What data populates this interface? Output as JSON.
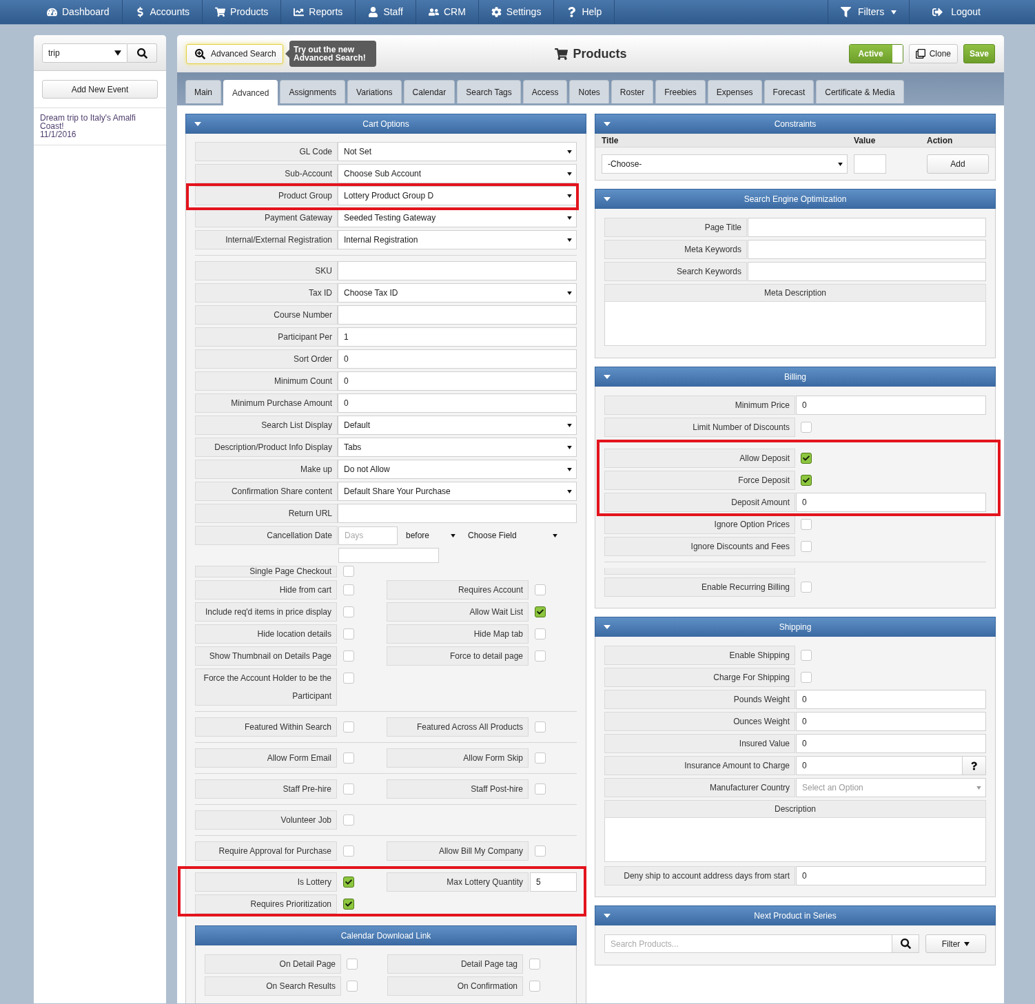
{
  "nav": {
    "items": [
      {
        "label": "Dashboard"
      },
      {
        "label": "Accounts"
      },
      {
        "label": "Products"
      },
      {
        "label": "Reports"
      },
      {
        "label": "Staff"
      },
      {
        "label": "CRM"
      },
      {
        "label": "Settings"
      },
      {
        "label": "Help"
      }
    ],
    "right_items": [
      {
        "label": "Filters",
        "kind": "menu"
      },
      {
        "label": "Logout",
        "kind": "link"
      }
    ]
  },
  "sidebar": {
    "search": {
      "value": "trip"
    },
    "add_button": "Add New Event",
    "events": [
      {
        "title": "Dream trip to Italy's Amalfi Coast!",
        "date": "11/1/2016"
      }
    ]
  },
  "header": {
    "advanced_search": {
      "label": "Advanced Search",
      "tooltip": "Try out the new Advanced Search!"
    },
    "title": "Products",
    "status": {
      "label": "Active",
      "on": true
    },
    "buttons": [
      {
        "label": "Clone",
        "kind": "clone"
      },
      {
        "label": "Save",
        "kind": "save"
      }
    ]
  },
  "tabs": [
    {
      "label": "Main",
      "selected": false
    },
    {
      "label": "Advanced",
      "selected": true
    },
    {
      "label": "Assignments",
      "selected": false
    },
    {
      "label": "Variations",
      "selected": false
    },
    {
      "label": "Calendar",
      "selected": false
    },
    {
      "label": "Search Tags",
      "selected": false
    },
    {
      "label": "Access",
      "selected": false
    },
    {
      "label": "Notes",
      "selected": false
    },
    {
      "label": "Roster",
      "selected": false
    },
    {
      "label": "Freebies",
      "selected": false
    },
    {
      "label": "Expenses",
      "selected": false
    },
    {
      "label": "Forecast",
      "selected": false
    },
    {
      "label": "Certificate & Media",
      "selected": false
    }
  ],
  "cart_options": {
    "title": "Cart Options",
    "sections": [
      {
        "rows": [
          {
            "kind": "select",
            "label": "GL Code",
            "value": "Not Set",
            "highlighted": false
          },
          {
            "kind": "select",
            "label": "Sub-Account",
            "value": "Choose Sub Account",
            "highlighted": false
          },
          {
            "kind": "select",
            "label": "Product Group",
            "value": "Lottery Product Group D",
            "highlighted": true
          },
          {
            "kind": "select",
            "label": "Payment Gateway",
            "value": "Seeded Testing Gateway",
            "highlighted": false
          },
          {
            "kind": "select",
            "label": "Internal/External Registration",
            "value": "Internal Registration",
            "highlighted": false
          }
        ]
      },
      {
        "rows": [
          {
            "kind": "text",
            "label": "SKU"
          },
          {
            "kind": "select",
            "label": "Tax ID",
            "value": "Choose Tax ID"
          },
          {
            "kind": "text",
            "label": "Course Number"
          },
          {
            "kind": "text",
            "label": "Participant Per",
            "value": "1"
          },
          {
            "kind": "text",
            "label": "Sort Order",
            "value": "0"
          },
          {
            "kind": "text",
            "label": "Minimum Count",
            "value": "0"
          },
          {
            "kind": "text",
            "label": "Minimum Purchase Amount",
            "value": "0"
          },
          {
            "kind": "select",
            "label": "Search List Display",
            "value": "Default"
          },
          {
            "kind": "select",
            "label": "Description/Product Info Display",
            "value": "Tabs"
          },
          {
            "kind": "select",
            "label": "Make up",
            "value": "Do not Allow"
          },
          {
            "kind": "select",
            "label": "Confirmation Share content",
            "value": "Default Share Your Purchase"
          },
          {
            "kind": "text",
            "label": "Return URL"
          },
          {
            "kind": "cancellation",
            "label": "Cancellation Date",
            "placeholder": "Days",
            "timing": "before",
            "field": "Choose Field"
          },
          {
            "kind": "blank_input"
          },
          {
            "kind": "checks",
            "left": {
              "label": "Single Page Checkout",
              "checked": false
            }
          },
          {
            "kind": "checks",
            "left": {
              "label": "Hide from cart",
              "checked": false
            },
            "right": {
              "kind": "checkbox",
              "label": "Requires Account",
              "checked": false
            }
          },
          {
            "kind": "checks",
            "left": {
              "label": "Include req'd items in price display",
              "checked": false
            },
            "right": {
              "kind": "checkbox",
              "label": "Allow Wait List",
              "checked": true
            }
          },
          {
            "kind": "checks",
            "left": {
              "label": "Hide location details",
              "checked": false
            },
            "right": {
              "kind": "checkbox",
              "label": "Hide Map tab",
              "checked": false
            }
          },
          {
            "kind": "checks",
            "left": {
              "label": "Show Thumbnail on Details Page",
              "checked": false
            },
            "right": {
              "kind": "checkbox",
              "label": "Force to detail page",
              "checked": false
            }
          },
          {
            "kind": "checks",
            "left": {
              "label": "Force the Account Holder to be the Participant",
              "checked": false
            }
          }
        ]
      },
      {
        "rows": [
          {
            "kind": "checks",
            "left": {
              "label": "Featured Within Search",
              "checked": false
            },
            "right": {
              "kind": "checkbox",
              "label": "Featured Across All Products",
              "checked": false
            }
          }
        ]
      },
      {
        "rows": [
          {
            "kind": "checks",
            "left": {
              "label": "Allow Form Email",
              "checked": false
            },
            "right": {
              "kind": "checkbox",
              "label": "Allow Form Skip",
              "checked": false
            }
          }
        ]
      },
      {
        "rows": [
          {
            "kind": "checks",
            "left": {
              "label": "Staff Pre-hire",
              "checked": false
            },
            "right": {
              "kind": "checkbox",
              "label": "Staff Post-hire",
              "checked": false
            }
          }
        ]
      },
      {
        "rows": [
          {
            "kind": "checks",
            "left": {
              "label": "Volunteer Job",
              "checked": false
            }
          }
        ]
      },
      {
        "rows": [
          {
            "kind": "checks",
            "left": {
              "label": "Require Approval for Purchase",
              "checked": false
            },
            "right": {
              "kind": "checkbox",
              "label": "Allow Bill My Company",
              "checked": false
            }
          }
        ]
      },
      {
        "rows": [
          {
            "kind": "checks",
            "highlighted": true,
            "left": {
              "label": "Is Lottery",
              "checked": true
            },
            "right": {
              "kind": "input",
              "label": "Max Lottery Quantity",
              "value": "5"
            }
          },
          {
            "kind": "checks",
            "highlighted": true,
            "left": {
              "label": "Requires Prioritization",
              "checked": true
            }
          }
        ]
      }
    ],
    "calendar_download": {
      "title": "Calendar Download Link",
      "rows": [
        {
          "left": {
            "label": "On Detail Page",
            "checked": false
          },
          "right": {
            "label": "Detail Page tag",
            "checked": false
          }
        },
        {
          "left": {
            "label": "On Search Results",
            "checked": false
          },
          "right": {
            "label": "On Confirmation",
            "checked": false
          }
        }
      ]
    }
  },
  "constraints": {
    "title": "Constraints",
    "columns": [
      "Title",
      "Value",
      "Action"
    ],
    "title_select": "-Choose-",
    "add_button": "Add"
  },
  "seo": {
    "title": "Search Engine Optimization",
    "rows": [
      {
        "kind": "text",
        "label": "Page Title"
      },
      {
        "kind": "text",
        "label": "Meta Keywords"
      },
      {
        "kind": "text",
        "label": "Search Keywords"
      },
      {
        "kind": "textarea",
        "label": "Meta Description"
      }
    ]
  },
  "billing": {
    "title": "Billing",
    "sections": [
      {
        "rows": [
          {
            "kind": "text",
            "label": "Minimum Price",
            "value": "0",
            "highlighted": false
          },
          {
            "kind": "checkbox",
            "label": "Limit Number of Discounts",
            "checked": false,
            "highlighted": false
          },
          {
            "kind": "checkbox",
            "label": "Allow Deposit",
            "checked": true,
            "highlighted": true
          },
          {
            "kind": "checkbox",
            "label": "Force Deposit",
            "checked": true,
            "highlighted": true
          },
          {
            "kind": "text",
            "label": "Deposit Amount",
            "value": "0",
            "highlighted": true
          },
          {
            "kind": "checkbox",
            "label": "Ignore Option Prices",
            "checked": false,
            "highlighted": false
          },
          {
            "kind": "checkbox",
            "label": "Ignore Discounts and Fees",
            "checked": false,
            "highlighted": false
          }
        ]
      },
      {
        "rows": [
          {
            "kind": "clipped"
          },
          {
            "kind": "checkbox",
            "label": "Enable Recurring Billing",
            "checked": false
          }
        ]
      }
    ]
  },
  "shipping": {
    "title": "Shipping",
    "rows": [
      {
        "kind": "checkbox",
        "label": "Enable Shipping",
        "checked": false
      },
      {
        "kind": "checkbox",
        "label": "Charge For Shipping",
        "checked": false
      },
      {
        "kind": "text",
        "label": "Pounds Weight",
        "value": "0"
      },
      {
        "kind": "text",
        "label": "Ounces Weight",
        "value": "0"
      },
      {
        "kind": "text",
        "label": "Insured Value",
        "value": "0"
      },
      {
        "kind": "text_help",
        "label": "Insurance Amount to Charge",
        "value": "0"
      },
      {
        "kind": "select",
        "label": "Manufacturer Country",
        "placeholder": "Select an Option"
      },
      {
        "kind": "textarea",
        "label": "Description"
      },
      {
        "kind": "text",
        "label": "Deny ship to account address days from start",
        "value": "0"
      }
    ]
  },
  "next_product": {
    "title": "Next Product in Series",
    "search_placeholder": "Search Products...",
    "filter_button": "Filter"
  }
}
